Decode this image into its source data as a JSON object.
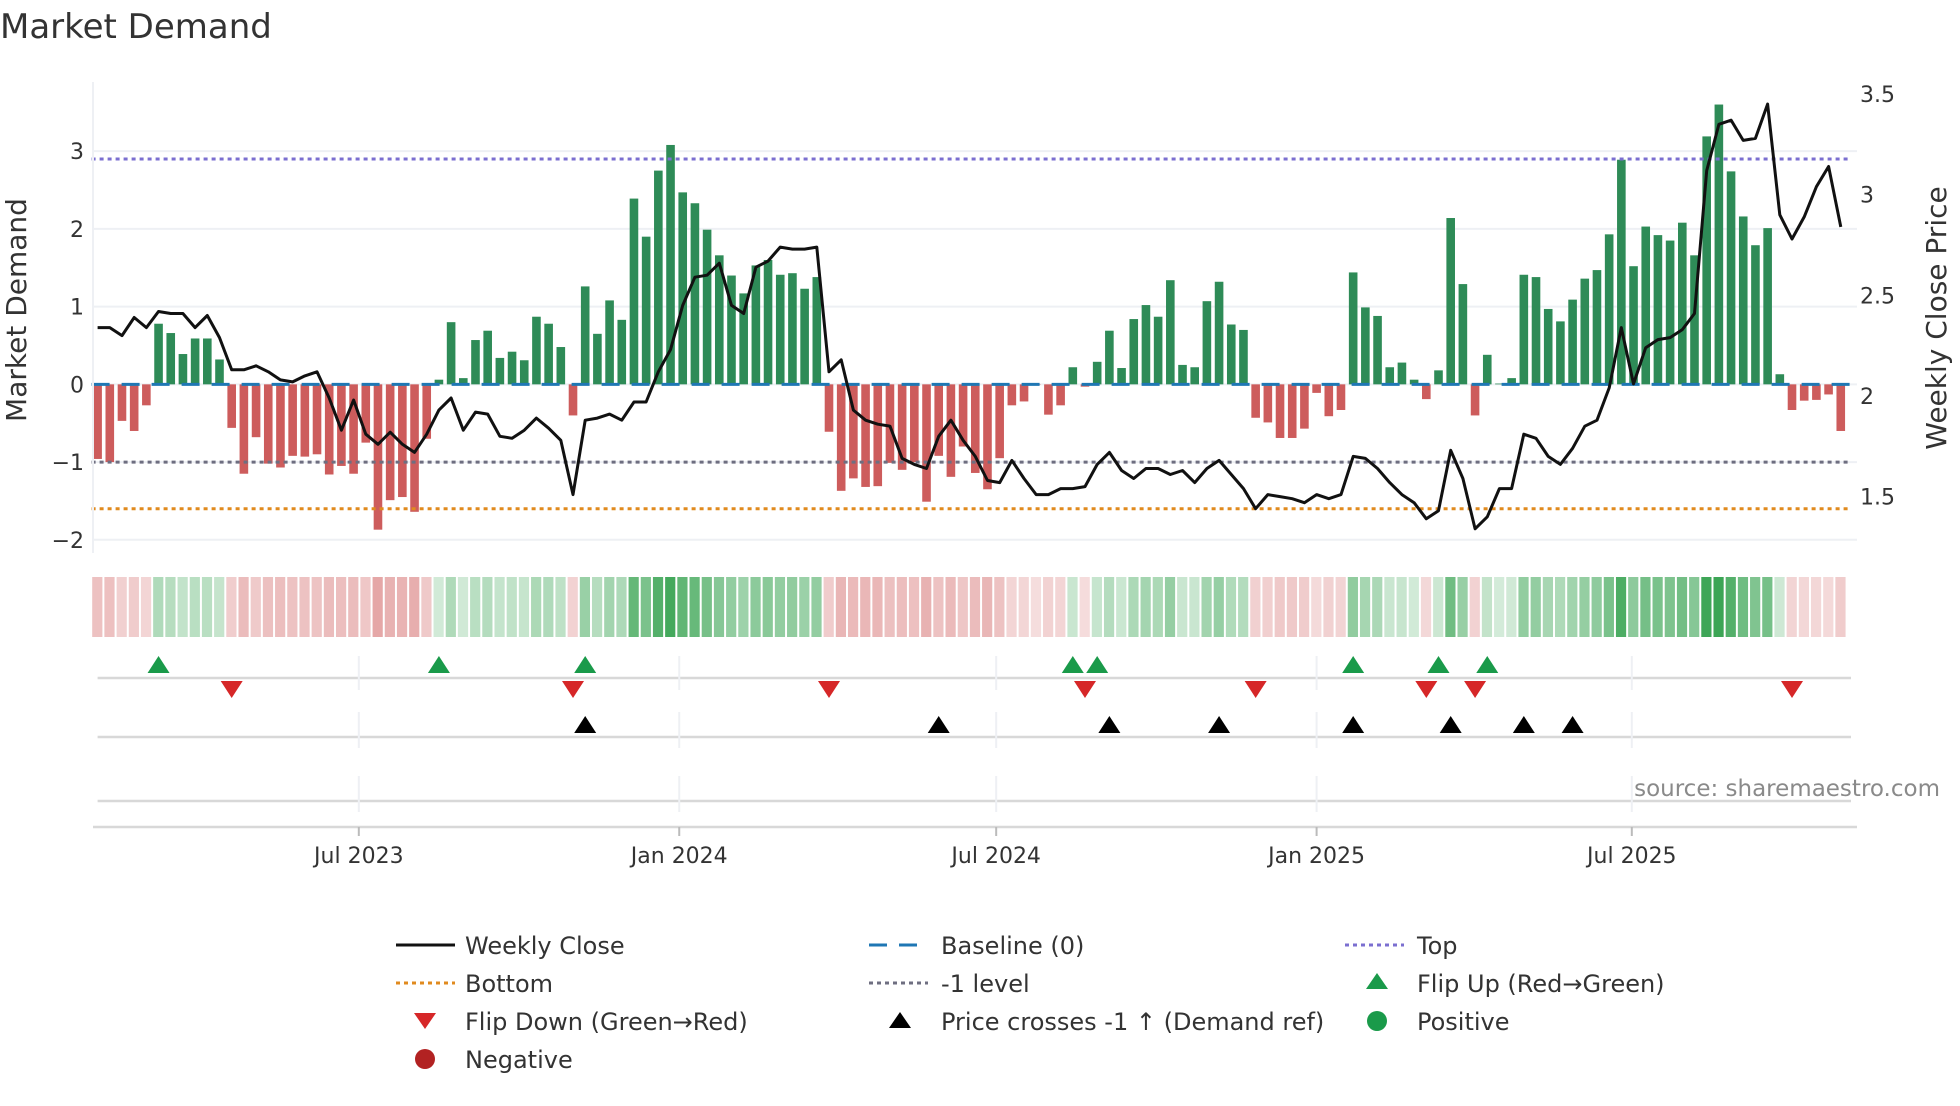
{
  "title": "Market Demand",
  "source": "source: sharemaestro.com",
  "chart_data": {
    "type": "bar+line",
    "title": "Market Demand",
    "x_start": "2023-02-01",
    "x_step_days": 7,
    "demand": [
      -0.96,
      -1.0,
      -0.47,
      -0.6,
      -0.27,
      0.78,
      0.66,
      0.39,
      0.59,
      0.59,
      0.32,
      -0.56,
      -1.15,
      -0.68,
      -1.02,
      -1.07,
      -0.92,
      -0.93,
      -0.9,
      -1.16,
      -1.05,
      -1.15,
      -0.75,
      -1.87,
      -1.49,
      -1.45,
      -1.64,
      -0.7,
      0.06,
      0.8,
      0.08,
      0.57,
      0.69,
      0.34,
      0.42,
      0.31,
      0.87,
      0.78,
      0.48,
      -0.4,
      1.26,
      0.65,
      1.08,
      0.83,
      2.39,
      1.9,
      2.75,
      3.08,
      2.47,
      2.33,
      1.99,
      1.66,
      1.4,
      1.17,
      1.53,
      1.6,
      1.41,
      1.43,
      1.23,
      1.38,
      -0.61,
      -1.37,
      -1.21,
      -1.32,
      -1.31,
      -1.01,
      -1.1,
      -1.0,
      -1.51,
      -0.92,
      -1.19,
      -0.8,
      -1.14,
      -1.35,
      -0.95,
      -0.27,
      -0.22,
      0,
      -0.39,
      -0.27,
      0.22,
      -0.03,
      0.29,
      0.69,
      0.21,
      0.84,
      1.02,
      0.87,
      1.34,
      0.25,
      0.22,
      1.07,
      1.32,
      0.77,
      0.7,
      -0.43,
      -0.49,
      -0.69,
      -0.69,
      -0.57,
      -0.11,
      -0.41,
      -0.33,
      1.44,
      0.99,
      0.88,
      0.22,
      0.28,
      0.06,
      -0.19,
      0.18,
      2.14,
      1.29,
      -0.4,
      0.38,
      0.01,
      0.08,
      1.41,
      1.38,
      0.97,
      0.81,
      1.09,
      1.36,
      1.47,
      1.93,
      2.89,
      1.52,
      2.03,
      1.92,
      1.85,
      2.08,
      1.66,
      3.19,
      3.6,
      2.74,
      2.16,
      1.79,
      2.01,
      0.13,
      -0.33,
      -0.21,
      -0.2,
      -0.13,
      -0.6
    ],
    "weekly_close": [
      2.34,
      2.34,
      2.3,
      2.39,
      2.34,
      2.42,
      2.41,
      2.41,
      2.34,
      2.4,
      2.29,
      2.13,
      2.13,
      2.15,
      2.12,
      2.08,
      2.07,
      2.1,
      2.12,
      1.99,
      1.83,
      1.98,
      1.81,
      1.76,
      1.82,
      1.76,
      1.72,
      1.81,
      1.93,
      1.99,
      1.83,
      1.92,
      1.91,
      1.8,
      1.79,
      1.83,
      1.89,
      1.84,
      1.78,
      1.51,
      1.88,
      1.89,
      1.91,
      1.88,
      1.97,
      1.97,
      2.12,
      2.23,
      2.45,
      2.59,
      2.6,
      2.66,
      2.45,
      2.41,
      2.64,
      2.67,
      2.74,
      2.73,
      2.73,
      2.74,
      2.12,
      2.18,
      1.93,
      1.88,
      1.86,
      1.85,
      1.69,
      1.66,
      1.64,
      1.8,
      1.88,
      1.78,
      1.7,
      1.58,
      1.57,
      1.68,
      1.59,
      1.51,
      1.51,
      1.54,
      1.54,
      1.55,
      1.66,
      1.72,
      1.63,
      1.59,
      1.64,
      1.64,
      1.61,
      1.63,
      1.57,
      1.64,
      1.68,
      1.61,
      1.54,
      1.44,
      1.51,
      1.5,
      1.49,
      1.47,
      1.51,
      1.49,
      1.51,
      1.7,
      1.69,
      1.64,
      1.57,
      1.51,
      1.47,
      1.39,
      1.43,
      1.73,
      1.59,
      1.34,
      1.4,
      1.54,
      1.54,
      1.81,
      1.79,
      1.7,
      1.66,
      1.74,
      1.85,
      1.88,
      2.04,
      2.34,
      2.06,
      2.24,
      2.28,
      2.29,
      2.33,
      2.41,
      3.12,
      3.35,
      3.37,
      3.27,
      3.28,
      3.45,
      2.9,
      2.78,
      2.89,
      3.04,
      3.14,
      2.84
    ],
    "ylabel_left": "Market Demand",
    "ylabel_right": "Weekly Close Price",
    "ylim_left": [
      -2.17,
      3.89
    ],
    "ylim_right": [
      1.22,
      3.56
    ],
    "yticks_left": [
      {
        "v": -2,
        "label": "−2"
      },
      {
        "v": -1,
        "label": "−1"
      },
      {
        "v": 0,
        "label": "0"
      },
      {
        "v": 1,
        "label": "1"
      },
      {
        "v": 2,
        "label": "2"
      },
      {
        "v": 3,
        "label": "3"
      }
    ],
    "yticks_right": [
      {
        "v": 1.5,
        "label": "1.5"
      },
      {
        "v": 2,
        "label": "2"
      },
      {
        "v": 2.5,
        "label": "2.5"
      },
      {
        "v": 3,
        "label": "3"
      },
      {
        "v": 3.5,
        "label": "3.5"
      }
    ],
    "xticks": [
      {
        "date": "2023-07-01",
        "label": "Jul 2023"
      },
      {
        "date": "2024-01-01",
        "label": "Jan 2024"
      },
      {
        "date": "2024-07-01",
        "label": "Jul 2024"
      },
      {
        "date": "2025-01-01",
        "label": "Jan 2025"
      },
      {
        "date": "2025-07-01",
        "label": "Jul 2025"
      }
    ],
    "levels": {
      "top": 2.9,
      "baseline": 0,
      "minus1": -1,
      "bottom": -1.6
    },
    "price_cross_indices": [
      40,
      69,
      83,
      92,
      103,
      111,
      117,
      121
    ],
    "grid": true,
    "legend_position": "bottom",
    "legend": {
      "weekly_close": "Weekly Close",
      "baseline": "Baseline (0)",
      "top": "Top",
      "bottom": "Bottom",
      "minus1": "-1 level",
      "flip_up": "Flip Up (Red→Green)",
      "flip_down": "Flip Down (Green→Red)",
      "price_cross": "Price crosses -1 ↑ (Demand ref)",
      "positive": "Positive",
      "negative": "Negative"
    },
    "colors": {
      "positive": "#2e8b57",
      "negative": "#cd5c5c",
      "line": "#111111",
      "baseline": "#1f77b4",
      "top": "#7b6fd0",
      "minus1": "#6e6e80",
      "bottom": "#e08a1e",
      "flip_up": "#1a9a4a",
      "flip_down": "#d62728",
      "cross": "#000000",
      "pos_dot": "#1a9a4a",
      "neg_dot": "#b22222"
    }
  }
}
